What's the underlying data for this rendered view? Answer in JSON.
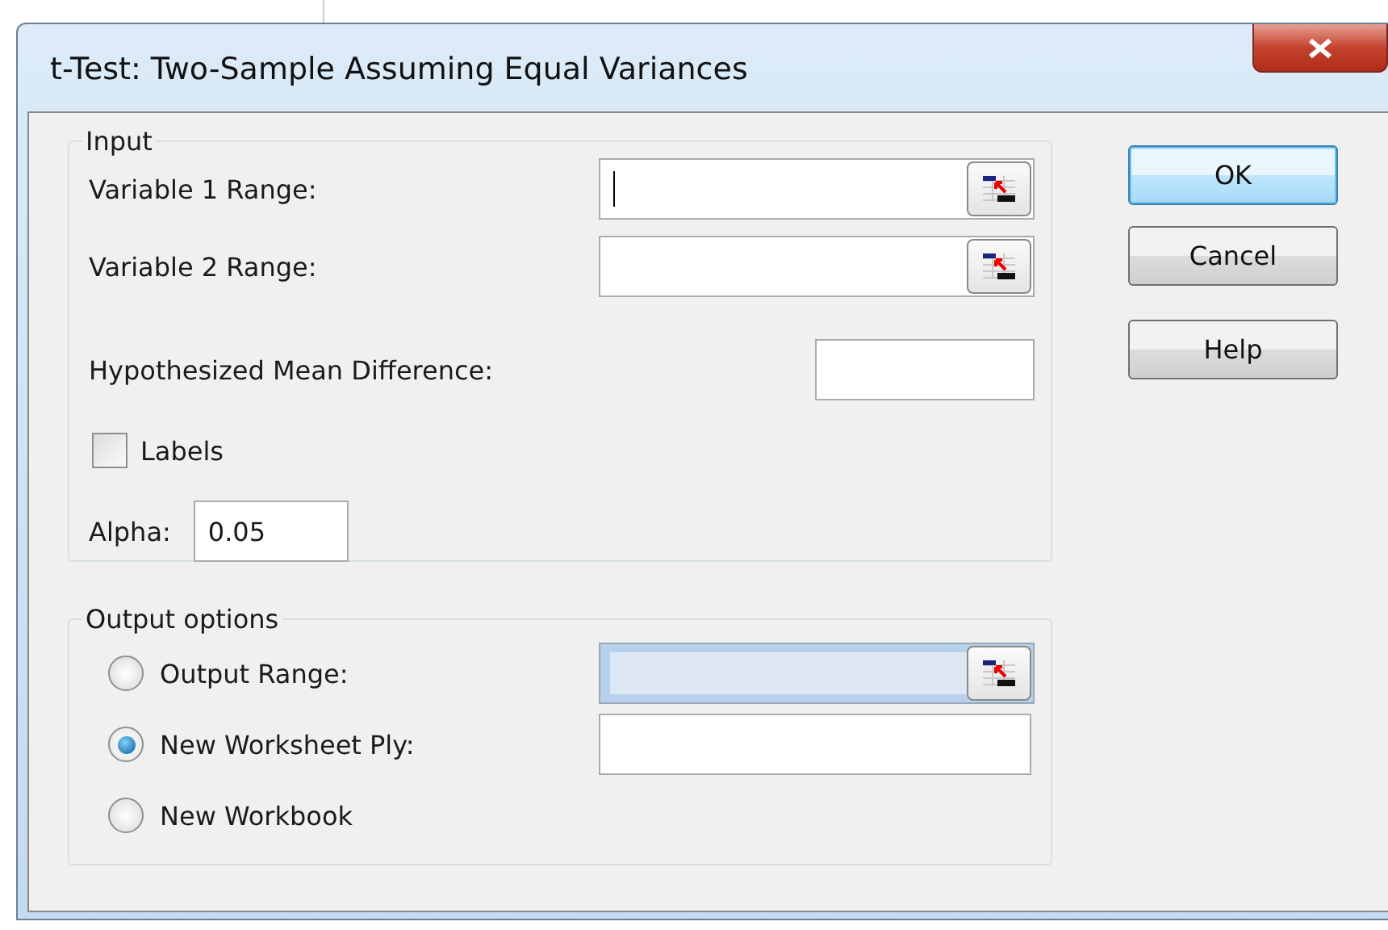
{
  "window": {
    "title": "t-Test: Two-Sample Assuming Equal Variances"
  },
  "input": {
    "title": "Input",
    "variable_1_range": {
      "label": "Variable 1 Range:",
      "focused": true
    },
    "variable_2_range": {
      "label": "Variable 2 Range:",
      "focused": false
    },
    "hypothesized_mean_difference": {
      "label": "Hypothesized Mean Difference:"
    },
    "labels": {
      "label": "Labels",
      "checked": false
    },
    "alpha": {
      "label": "Alpha:",
      "value": "0.05"
    }
  },
  "output_options": {
    "title": "Output options",
    "options": [
      {
        "label": "Output Range:",
        "selected": false,
        "kind": "range"
      },
      {
        "label": "New Worksheet Ply:",
        "selected": true,
        "kind": "text"
      },
      {
        "label": "New Workbook",
        "selected": false,
        "kind": "plain"
      }
    ]
  },
  "buttons": [
    {
      "label": "OK",
      "default": true
    },
    {
      "label": "Cancel",
      "default": false
    },
    {
      "label": "Help",
      "default": false
    }
  ]
}
